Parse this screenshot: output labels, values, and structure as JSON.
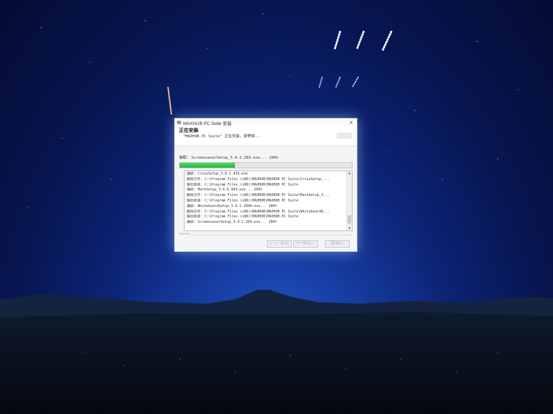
{
  "window": {
    "title": "MAXHUB PC Suite 安装",
    "close_label": "✕"
  },
  "header": {
    "title": "正在安装",
    "subtitle": "\"MAXHUB PC Suite\" 正在安装，请等候..."
  },
  "status": {
    "current": "抽取: ScreensaverSetup_3.4.1.269.exe... 100%",
    "progress_fraction": 0.32
  },
  "log": {
    "lines": [
      "抽取: CriusSetup_3.8.1.433.exe",
      "删除文件: C:\\Program Files (x86)\\MAXHUB\\MAXHUB PC Suite\\CriusSetup_...",
      "输出目录: C:\\Program Files (x86)\\MAXHUB\\MAXHUB PC Suite",
      "抽取: MarkSetup_3.6.0.983.exe... 100%",
      "删除文件: C:\\Program Files (x86)\\MAXHUB\\MAXHUB PC Suite\\MarkSetup_3...",
      "输出目录: C:\\Program Files (x86)\\MAXHUB\\MAXHUB PC Suite",
      "抽取: WhiteboardSetup_3.6.1.2008.exe... 100%",
      "删除文件: C:\\Program Files (x86)\\MAXHUB\\MAXHUB PC Suite\\Whiteboard6...",
      "输出目录: C:\\Program Files (x86)\\MAXHUB\\MAXHUB PC Suite",
      "抽取: ScreensaverSetup_3.4.1.269.exe... 100%"
    ]
  },
  "footer": {
    "brand": "MAXHUB",
    "back": "< 上一步(P)",
    "next": "下一步(N) >",
    "cancel": "取消(C)"
  },
  "colors": {
    "progress": "#22b63a",
    "desktop_top": "#050c33",
    "desktop_glow": "#2c6bd6"
  }
}
